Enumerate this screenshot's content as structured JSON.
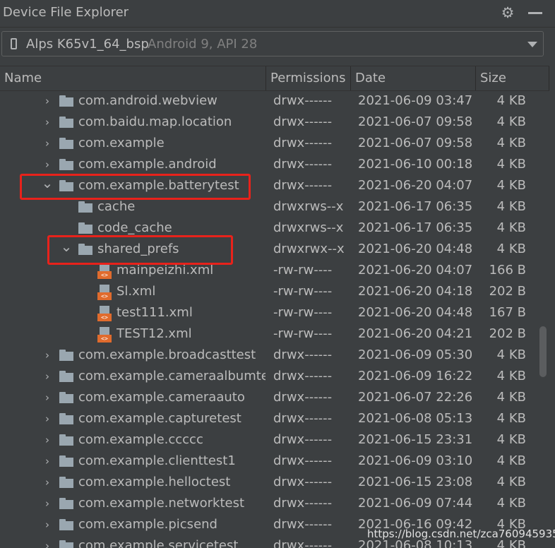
{
  "window": {
    "title": "Device File Explorer"
  },
  "device_selector": {
    "device_name": "Alps K65v1_64_bsp",
    "device_api": "Android 9, API 28"
  },
  "columns": {
    "name": "Name",
    "permissions": "Permissions",
    "date": "Date",
    "size": "Size"
  },
  "rows": [
    {
      "name": "com.android.webview",
      "perm": "drwx------",
      "date": "2021-06-09 03:47",
      "size": "4 KB",
      "type": "folder",
      "level": 0,
      "expanded": false
    },
    {
      "name": "com.baidu.map.location",
      "perm": "drwx------",
      "date": "2021-06-07 09:58",
      "size": "4 KB",
      "type": "folder",
      "level": 0,
      "expanded": false
    },
    {
      "name": "com.example",
      "perm": "drwx------",
      "date": "2021-06-07 09:58",
      "size": "4 KB",
      "type": "folder",
      "level": 0,
      "expanded": false
    },
    {
      "name": "com.example.android",
      "perm": "drwx------",
      "date": "2021-06-10 00:18",
      "size": "4 KB",
      "type": "folder",
      "level": 0,
      "expanded": false
    },
    {
      "name": "com.example.batterytest",
      "perm": "drwx------",
      "date": "2021-06-20 04:07",
      "size": "4 KB",
      "type": "folder",
      "level": 0,
      "expanded": true
    },
    {
      "name": "cache",
      "perm": "drwxrws--x",
      "date": "2021-06-17 06:35",
      "size": "4 KB",
      "type": "folder",
      "level": 1,
      "leaf": true
    },
    {
      "name": "code_cache",
      "perm": "drwxrws--x",
      "date": "2021-06-17 06:35",
      "size": "4 KB",
      "type": "folder",
      "level": 1,
      "leaf": true
    },
    {
      "name": "shared_prefs",
      "perm": "drwxrwx--x",
      "date": "2021-06-20 04:48",
      "size": "4 KB",
      "type": "folder",
      "level": 1,
      "expanded": true
    },
    {
      "name": "mainpeizhi.xml",
      "perm": "-rw-rw----",
      "date": "2021-06-20 04:07",
      "size": "166 B",
      "type": "xml",
      "level": 2
    },
    {
      "name": "Sl.xml",
      "perm": "-rw-rw----",
      "date": "2021-06-20 04:18",
      "size": "202 B",
      "type": "xml",
      "level": 2
    },
    {
      "name": "test111.xml",
      "perm": "-rw-rw----",
      "date": "2021-06-20 04:48",
      "size": "167 B",
      "type": "xml",
      "level": 2
    },
    {
      "name": "TEST12.xml",
      "perm": "-rw-rw----",
      "date": "2021-06-20 04:21",
      "size": "202 B",
      "type": "xml",
      "level": 2
    },
    {
      "name": "com.example.broadcasttest",
      "perm": "drwx------",
      "date": "2021-06-09 05:30",
      "size": "4 KB",
      "type": "folder",
      "level": 0,
      "expanded": false
    },
    {
      "name": "com.example.cameraalbumtest",
      "perm": "drwx------",
      "date": "2021-06-09 16:22",
      "size": "4 KB",
      "type": "folder",
      "level": 0,
      "expanded": false
    },
    {
      "name": "com.example.cameraauto",
      "perm": "drwx------",
      "date": "2021-06-07 22:26",
      "size": "4 KB",
      "type": "folder",
      "level": 0,
      "expanded": false
    },
    {
      "name": "com.example.capturetest",
      "perm": "drwx------",
      "date": "2021-06-08 05:13",
      "size": "4 KB",
      "type": "folder",
      "level": 0,
      "expanded": false
    },
    {
      "name": "com.example.ccccc",
      "perm": "drwx------",
      "date": "2021-06-15 23:31",
      "size": "4 KB",
      "type": "folder",
      "level": 0,
      "expanded": false
    },
    {
      "name": "com.example.clienttest1",
      "perm": "drwx------",
      "date": "2021-06-09 03:10",
      "size": "4 KB",
      "type": "folder",
      "level": 0,
      "expanded": false
    },
    {
      "name": "com.example.helloctest",
      "perm": "drwx------",
      "date": "2021-06-15 23:08",
      "size": "4 KB",
      "type": "folder",
      "level": 0,
      "expanded": false
    },
    {
      "name": "com.example.networktest",
      "perm": "drwx------",
      "date": "2021-06-09 07:44",
      "size": "4 KB",
      "type": "folder",
      "level": 0,
      "expanded": false
    },
    {
      "name": "com.example.picsend",
      "perm": "drwx------",
      "date": "2021-06-16 09:42",
      "size": "4 KB",
      "type": "folder",
      "level": 0,
      "expanded": false
    },
    {
      "name": "com.example.servicetest",
      "perm": "drwx------",
      "date": "2021-06-08 10:13",
      "size": "4 KB",
      "type": "folder",
      "level": 0,
      "expanded": false
    }
  ],
  "watermark": "https://blog.csdn.net/zca760945935",
  "colors": {
    "background": "#3c3f41",
    "text": "#bbbbbb",
    "folder": "#9aa7b0",
    "highlight": "#e8221b"
  }
}
